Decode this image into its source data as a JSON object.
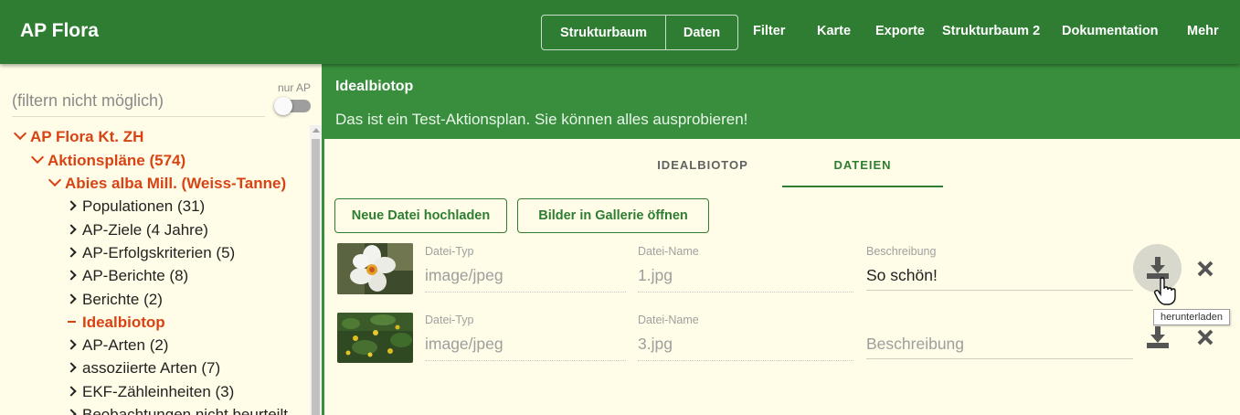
{
  "app": {
    "title": "AP Flora"
  },
  "nav": {
    "group": [
      "Strukturbaum",
      "Daten"
    ],
    "links": [
      "Filter",
      "Karte",
      "Exporte",
      "Strukturbaum 2",
      "Dokumentation",
      "Mehr"
    ]
  },
  "sidebar": {
    "filter_placeholder": "(filtern nicht möglich)",
    "toggle_label": "nur AP",
    "tree": [
      {
        "label": "AP Flora Kt. ZH",
        "style": "open"
      },
      {
        "label": "Aktionspläne (574)",
        "style": "open"
      },
      {
        "label": "Abies alba Mill. (Weiss-Tanne)",
        "style": "open"
      },
      {
        "label": "Populationen (31)",
        "style": "closed"
      },
      {
        "label": "AP-Ziele (4 Jahre)",
        "style": "closed"
      },
      {
        "label": "AP-Erfolgskriterien (5)",
        "style": "closed"
      },
      {
        "label": "AP-Berichte (8)",
        "style": "closed"
      },
      {
        "label": "Berichte (2)",
        "style": "closed"
      },
      {
        "label": "Idealbiotop",
        "style": "active"
      },
      {
        "label": "AP-Arten (2)",
        "style": "closed"
      },
      {
        "label": "assoziierte Arten (7)",
        "style": "closed"
      },
      {
        "label": "EKF-Zähleinheiten (3)",
        "style": "closed"
      },
      {
        "label": "Beobachtungen nicht beurteilt",
        "style": "closed"
      }
    ]
  },
  "main": {
    "title": "Idealbiotop",
    "subtitle": "Das ist ein Test-Aktionsplan. Sie können alles ausprobieren!",
    "tabs": [
      "IDEALBIOTOP",
      "DATEIEN"
    ],
    "active_tab": "DATEIEN",
    "buttons": {
      "upload": "Neue Datei hochladen",
      "gallery": "Bilder in Gallerie öffnen"
    },
    "labels": {
      "type": "Datei-Typ",
      "name": "Datei-Name",
      "description": "Beschreibung"
    },
    "files": [
      {
        "type": "image/jpeg",
        "name": "1.jpg",
        "description": "So schön!"
      },
      {
        "type": "image/jpeg",
        "name": "3.jpg",
        "description": "Beschreibung"
      }
    ],
    "tooltip": "herunterladen"
  },
  "colors": {
    "appbar": "#2e7d32",
    "header": "#388e3c",
    "accent_red": "#d84315",
    "background": "#fffde7"
  },
  "icons": [
    "download-icon",
    "close-icon",
    "hand-cursor-icon",
    "chevron-down-icon",
    "chevron-right-icon"
  ]
}
